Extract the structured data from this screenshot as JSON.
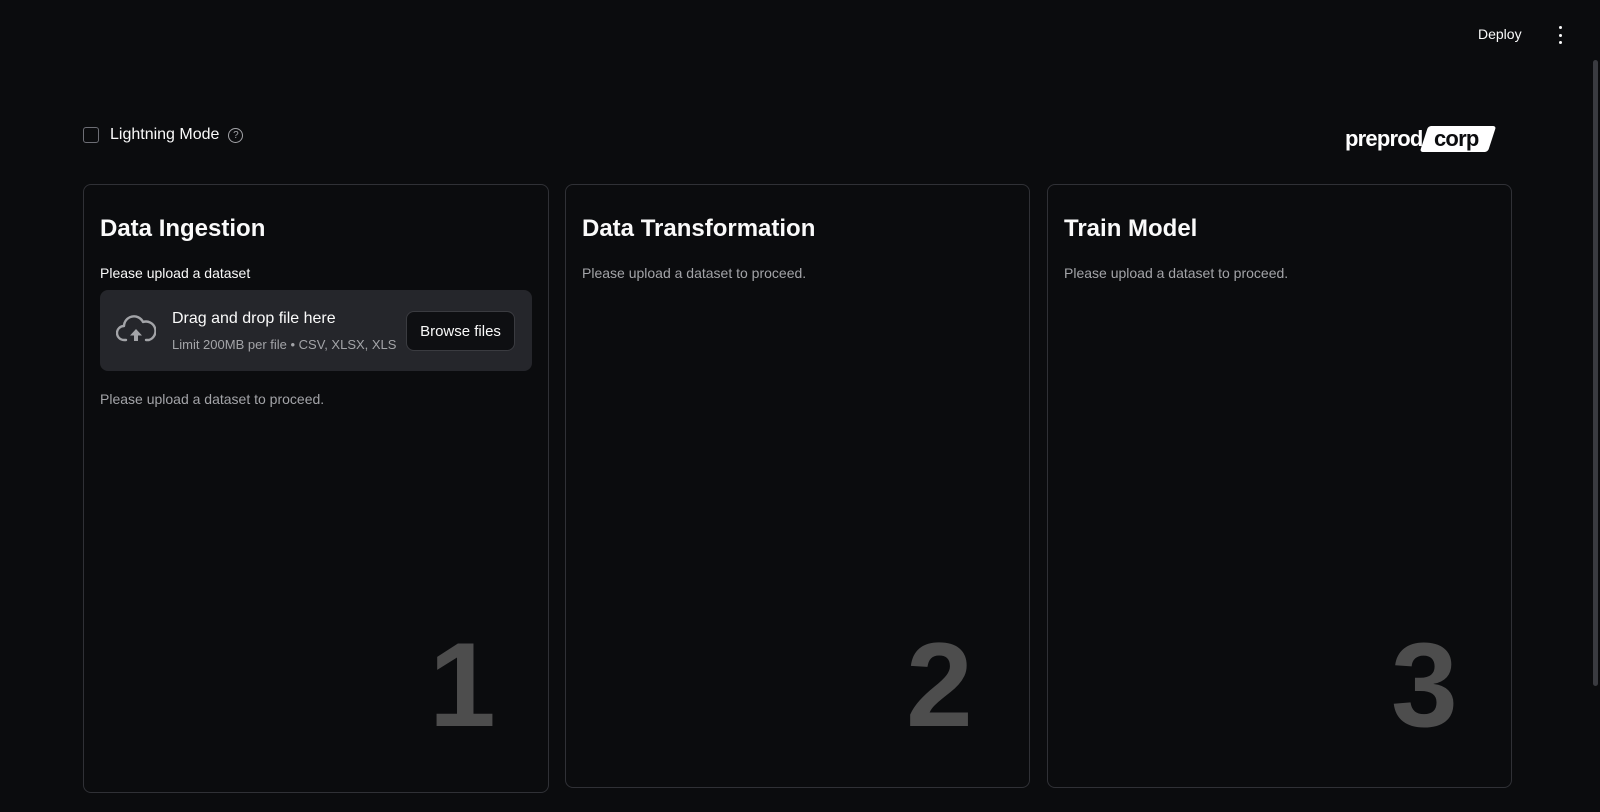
{
  "header": {
    "deploy_label": "Deploy",
    "menu_icon": "kebab-menu-icon"
  },
  "lightning_mode": {
    "label": "Lightning Mode",
    "checked": false,
    "help_icon": "question-circle-icon"
  },
  "logo": {
    "text_part1": "preprod",
    "text_part2": "corp"
  },
  "cards": [
    {
      "title": "Data Ingestion",
      "upload_label": "Please upload a dataset",
      "dropzone": {
        "icon": "cloud-upload-icon",
        "title": "Drag and drop file here",
        "subtitle": "Limit 200MB per file • CSV, XLSX, XLS",
        "button_label": "Browse files"
      },
      "status": "Please upload a dataset to proceed.",
      "step": "1"
    },
    {
      "title": "Data Transformation",
      "status": "Please upload a dataset to proceed.",
      "step": "2"
    },
    {
      "title": "Train Model",
      "status": "Please upload a dataset to proceed.",
      "step": "3"
    }
  ],
  "colors": {
    "background": "#0b0c0e",
    "card_border": "#303136",
    "dropzone_bg": "#25262b",
    "muted_text": "#a3a4a8",
    "step_number": "#4d4d4d"
  }
}
